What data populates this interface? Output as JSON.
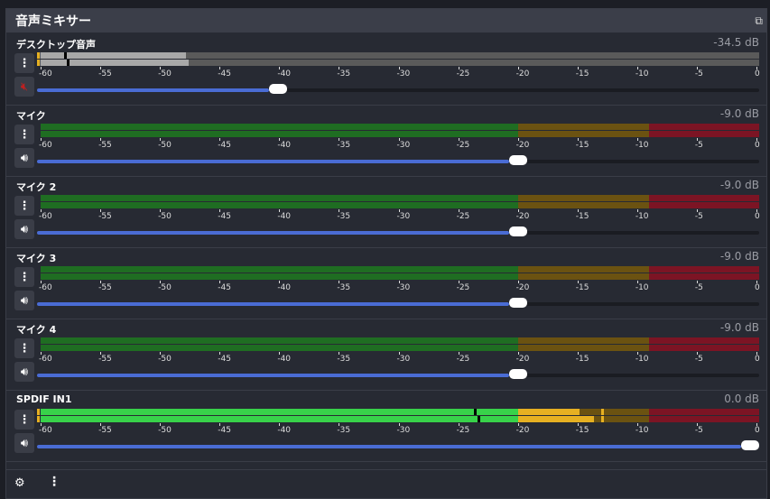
{
  "title": "音声ミキサー",
  "scale_labels": [
    "-60",
    "-55",
    "-50",
    "-45",
    "-40",
    "-35",
    "-30",
    "-25",
    "-20",
    "-15",
    "-10",
    "-5",
    "0"
  ],
  "colors": {
    "green_bg": "#1f6d22",
    "yellow_bg": "#6b5211",
    "red_bg": "#7c1424",
    "green": "#38d24a",
    "yellow": "#e6b022",
    "red": "#e02030",
    "muted_active": "#a8a8a8",
    "muted_bg": "#5a5a5a",
    "volume": "#4a6cd4"
  },
  "channels": [
    {
      "name": "デスクトップ音声",
      "db": "-34.5 dB",
      "muted": true,
      "volume_percent": 33,
      "levels_db": [
        -47.8,
        -47.6
      ],
      "peaks_db": [
        -58,
        -57.8
      ]
    },
    {
      "name": "マイク",
      "db": "-9.0 dB",
      "muted": false,
      "volume_percent": 67,
      "levels_db": [
        -60,
        -60
      ],
      "peaks_db": [
        null,
        null
      ]
    },
    {
      "name": "マイク 2",
      "db": "-9.0 dB",
      "muted": false,
      "volume_percent": 67,
      "levels_db": [
        -60,
        -60
      ],
      "peaks_db": [
        null,
        null
      ]
    },
    {
      "name": "マイク 3",
      "db": "-9.0 dB",
      "muted": false,
      "volume_percent": 67,
      "levels_db": [
        -60,
        -60
      ],
      "peaks_db": [
        null,
        null
      ]
    },
    {
      "name": "マイク 4",
      "db": "-9.0 dB",
      "muted": false,
      "volume_percent": 67,
      "levels_db": [
        -60,
        -60
      ],
      "peaks_db": [
        null,
        null
      ]
    },
    {
      "name": "SPDIF IN1",
      "db": "0.0 dB",
      "muted": false,
      "volume_percent": 100,
      "levels_db": [
        -14.8,
        -13.6
      ],
      "peaks_db": [
        -23.7,
        -23.4
      ]
    }
  ]
}
